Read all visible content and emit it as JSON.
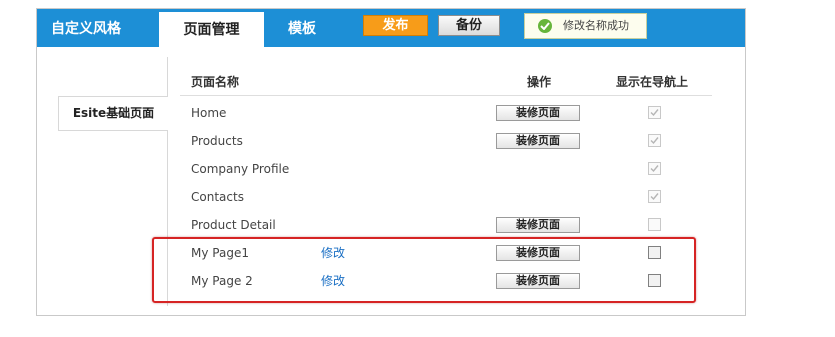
{
  "header": {
    "tabs": [
      {
        "label": "自定义风格"
      },
      {
        "label": "页面管理"
      },
      {
        "label": "模板"
      }
    ],
    "publish_label": "发布",
    "backup_label": "备份",
    "status_message": "修改名称成功"
  },
  "sidebar": {
    "tab_label": "Esite基础页面"
  },
  "table": {
    "columns": [
      "页面名称",
      "操作",
      "显示在导航上"
    ],
    "rows": [
      {
        "name": "Home",
        "edit": "",
        "action": "装修页面",
        "checked": true,
        "enabled": false
      },
      {
        "name": "Products",
        "edit": "",
        "action": "装修页面",
        "checked": true,
        "enabled": false
      },
      {
        "name": "Company Profile",
        "edit": "",
        "action": "",
        "checked": true,
        "enabled": false
      },
      {
        "name": "Contacts",
        "edit": "",
        "action": "",
        "checked": true,
        "enabled": false
      },
      {
        "name": "Product Detail",
        "edit": "",
        "action": "装修页面",
        "checked": false,
        "enabled": false
      },
      {
        "name": "My Page1",
        "edit": "修改",
        "action": "装修页面",
        "checked": false,
        "enabled": true
      },
      {
        "name": "My Page 2",
        "edit": "修改",
        "action": "装修页面",
        "checked": false,
        "enabled": true
      }
    ]
  },
  "colors": {
    "header_bg": "#1d8fd6",
    "publish_bg": "#f79c19",
    "highlight_border": "#d62424",
    "link": "#1a6fc4"
  }
}
